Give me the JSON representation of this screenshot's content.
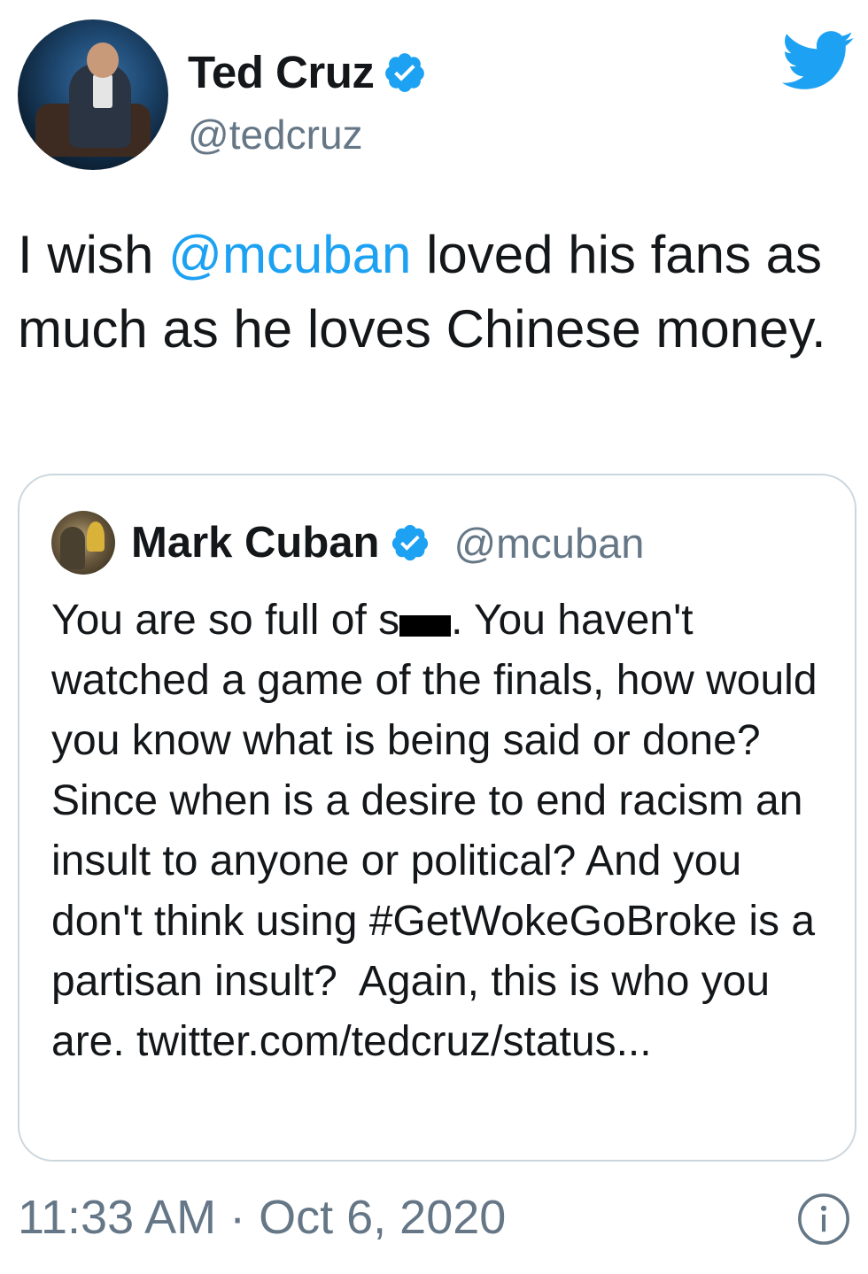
{
  "author": {
    "display_name": "Ted Cruz",
    "handle": "@tedcruz",
    "verified": true
  },
  "tweet": {
    "text_before": "I wish ",
    "mention": "@mcuban",
    "text_after": " loved his fans as much as he loves Chinese money."
  },
  "quoted_tweet": {
    "display_name": "Mark Cuban",
    "handle": "@mcuban",
    "verified": true,
    "text_part1": "You are so full of s",
    "text_part2": ". You haven't watched a game of the finals, how would you know what is being said or done? Since when is a desire to end racism an insult to anyone or political? And you don't think using #GetWokeGoBroke is a partisan insult?  Again, this is who you are. twitter.com/tedcruz/status..."
  },
  "footer": {
    "timestamp": "11:33 AM · Oct 6, 2020"
  },
  "icons": {
    "brand": "twitter-bird-icon",
    "verified": "verified-badge-icon",
    "info": "info-icon"
  },
  "colors": {
    "accent": "#1da1f2",
    "secondary_text": "#657786",
    "border": "#ccd6dd"
  }
}
